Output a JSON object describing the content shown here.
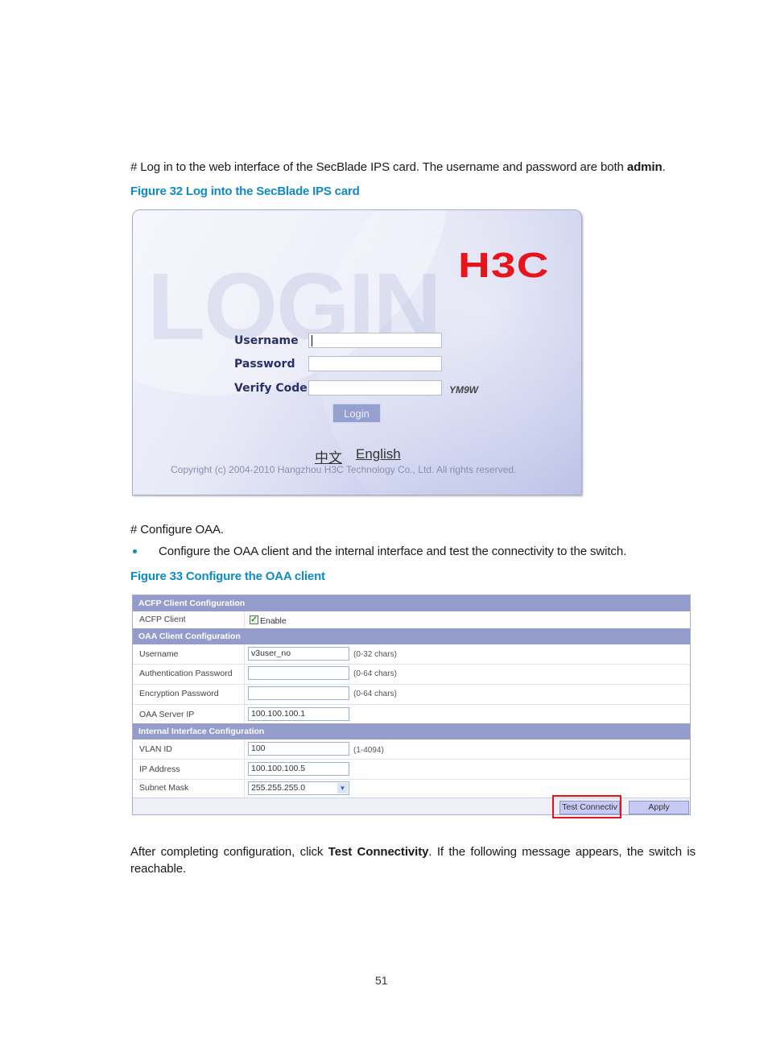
{
  "intro": {
    "prefix": "# Log in to the web interface of the SecBlade IPS card. The username and password are both ",
    "bold": "admin",
    "suffix": "."
  },
  "figure32": {
    "caption": "Figure 32 Log into the SecBlade IPS card",
    "watermark": "LOGIN",
    "logo": "H3C",
    "fields": {
      "username_label": "Username",
      "username_value": "",
      "password_label": "Password",
      "password_value": "",
      "verify_label": "Verify Code",
      "verify_value": "",
      "verify_code": "YM9W"
    },
    "login_button": "Login",
    "lang_chinese": "中文",
    "lang_english": "English",
    "copyright": "Copyright (c) 2004-2010 Hangzhou H3C Technology Co., Ltd. All rights reserved.",
    "brand_color": "#e8141c"
  },
  "configure": {
    "heading": "# Configure OAA.",
    "bullet": "Configure the OAA client and the internal interface and test the connectivity to the switch."
  },
  "figure33": {
    "caption": "Figure 33 Configure the OAA client",
    "sections": {
      "acfp": "ACFP Client Configuration",
      "oaa": "OAA Client Configuration",
      "internal": "Internal Interface Configuration"
    },
    "acfp_client": {
      "label": "ACFP Client",
      "checkbox_label": "Enable",
      "checked": true
    },
    "username": {
      "label": "Username",
      "value": "v3user_no",
      "hint": "(0-32 chars)"
    },
    "auth_password": {
      "label": "Authentication Password",
      "value": "",
      "hint": "(0-64 chars)"
    },
    "enc_password": {
      "label": "Encryption Password",
      "value": "",
      "hint": "(0-64 chars)"
    },
    "server_ip": {
      "label": "OAA Server IP",
      "value": "100.100.100.1"
    },
    "vlan_id": {
      "label": "VLAN ID",
      "value": "100",
      "hint": "(1-4094)"
    },
    "ip_address": {
      "label": "IP Address",
      "value": "100.100.100.5"
    },
    "subnet_mask": {
      "label": "Subnet Mask",
      "value": "255.255.255.0"
    },
    "test_button": "Test Connectiv",
    "apply_button": "Apply",
    "header_color": "#949ccb",
    "highlight_color": "#e8101a"
  },
  "after": {
    "prefix": "After completing configuration, click ",
    "bold": "Test Connectivity",
    "suffix": ". If the following message appears, the switch is",
    "line2": "reachable."
  },
  "page_number": "51"
}
